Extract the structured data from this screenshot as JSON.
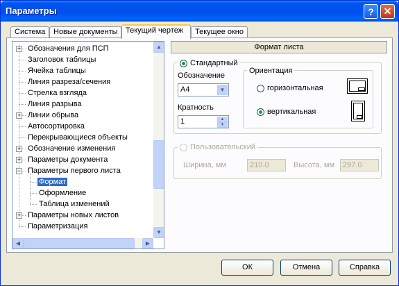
{
  "window": {
    "title": "Параметры",
    "help_button": "?",
    "close_button": "✕"
  },
  "tabs": [
    {
      "label": "Система",
      "active": false
    },
    {
      "label": "Новые документы",
      "active": false
    },
    {
      "label": "Текущий чертеж",
      "active": true
    },
    {
      "label": "Текущее окно",
      "active": false
    }
  ],
  "tree": {
    "items": [
      {
        "label": "Обозначения для ПСП",
        "level": 0,
        "expander": "+"
      },
      {
        "label": "Заголовок таблицы",
        "level": 0,
        "expander": ""
      },
      {
        "label": "Ячейка таблицы",
        "level": 0,
        "expander": ""
      },
      {
        "label": "Линия разреза/сечения",
        "level": 0,
        "expander": ""
      },
      {
        "label": "Стрелка взгляда",
        "level": 0,
        "expander": ""
      },
      {
        "label": "Линия разрыва",
        "level": 0,
        "expander": ""
      },
      {
        "label": "Линии обрыва",
        "level": 0,
        "expander": "+"
      },
      {
        "label": "Автосортировка",
        "level": 0,
        "expander": ""
      },
      {
        "label": "Перекрывающиеся объекты",
        "level": 0,
        "expander": ""
      },
      {
        "label": "Обозначение изменения",
        "level": 0,
        "expander": "+"
      },
      {
        "label": "Параметры документа",
        "level": 0,
        "expander": "+"
      },
      {
        "label": "Параметры первого листа",
        "level": 0,
        "expander": "−"
      },
      {
        "label": "Формат",
        "level": 1,
        "expander": "",
        "selected": true
      },
      {
        "label": "Оформление",
        "level": 1,
        "expander": ""
      },
      {
        "label": "Таблица изменений",
        "level": 1,
        "expander": ""
      },
      {
        "label": "Параметры новых листов",
        "level": 0,
        "expander": "+"
      },
      {
        "label": "Параметризация",
        "level": 0,
        "expander": ""
      }
    ]
  },
  "panel": {
    "header": "Формат листа",
    "standard": {
      "label": "Стандартный",
      "selected": true,
      "designation_label": "Обозначение",
      "designation_value": "А4",
      "multiplicity_label": "Кратность",
      "multiplicity_value": "1",
      "orientation": {
        "label": "Ориентация",
        "horizontal_label": "горизонтальная",
        "vertical_label": "вертикальная",
        "selected": "vertical"
      }
    },
    "custom": {
      "label": "Пользовательский",
      "selected": false,
      "width_label": "Ширина, мм",
      "width_value": "210.0",
      "height_label": "Высота, мм",
      "height_value": "297.0"
    }
  },
  "buttons": {
    "ok": "ОК",
    "cancel": "Отмена",
    "help": "Справка"
  }
}
